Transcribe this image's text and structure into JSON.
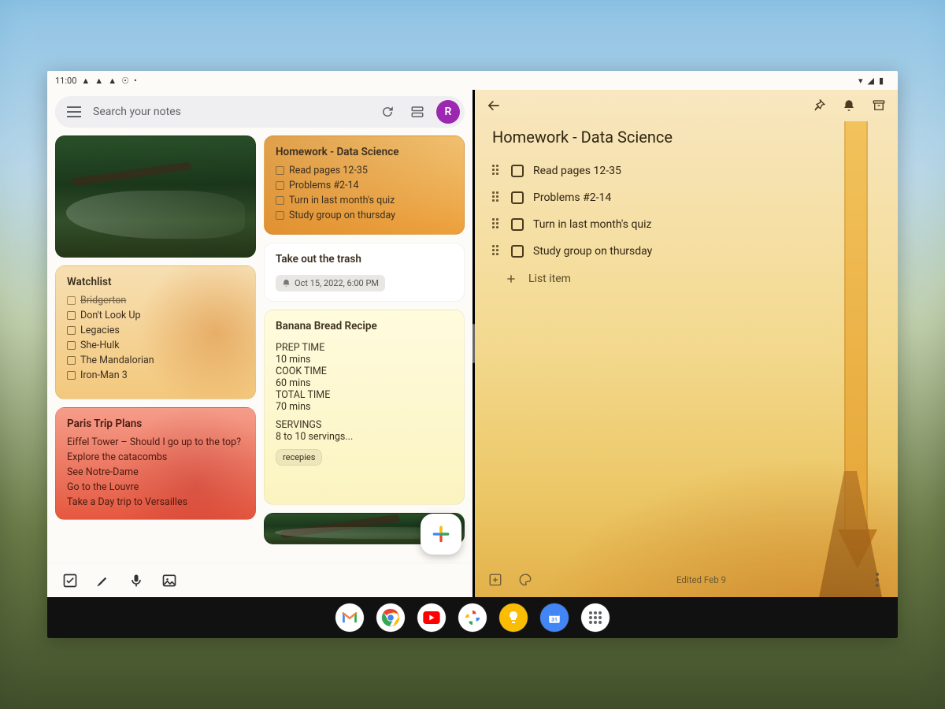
{
  "status": {
    "time": "11:00",
    "battery": "",
    "wifi": ""
  },
  "search": {
    "placeholder": "Search your notes",
    "avatar_initial": "R"
  },
  "notes": {
    "watchlist": {
      "title": "Watchlist",
      "items": [
        "Bridgerton",
        "Don't Look Up",
        "Legacies",
        "She-Hulk",
        "The Mandalorian",
        "Iron-Man 3"
      ],
      "struck_idx": 0
    },
    "paris": {
      "title": "Paris Trip Plans",
      "lines": [
        "Eiffel Tower – Should I go up to the top?",
        "Explore the catacombs",
        "See Notre-Dame",
        "Go to the Louvre",
        "Take a Day trip to Versailles"
      ]
    },
    "homework": {
      "title": "Homework - Data Science",
      "items": [
        "Read pages 12-35",
        "Problems #2-14",
        "Turn in last month's quiz",
        "Study group on thursday"
      ]
    },
    "trash": {
      "title": "Take out the trash",
      "reminder": "Oct 15, 2022, 6:00 PM"
    },
    "recipe": {
      "title": "Banana Bread Recipe",
      "body": [
        "PREP TIME",
        "10 mins",
        "COOK TIME",
        "60 mins",
        "TOTAL TIME",
        "70 mins",
        "",
        "SERVINGS",
        "8 to 10 servings..."
      ],
      "tag": "recepies"
    }
  },
  "detail": {
    "title": "Homework - Data Science",
    "items": [
      "Read pages 12-35",
      "Problems #2-14",
      "Turn in last month's quiz",
      "Study group on thursday"
    ],
    "add_label": "List item",
    "edited": "Edited Feb 9"
  },
  "toolbar_icons": [
    "checkbox",
    "brush",
    "mic",
    "image"
  ],
  "taskbar_apps": [
    "gmail",
    "chrome",
    "youtube",
    "photos",
    "keep",
    "calendar",
    "apps"
  ]
}
